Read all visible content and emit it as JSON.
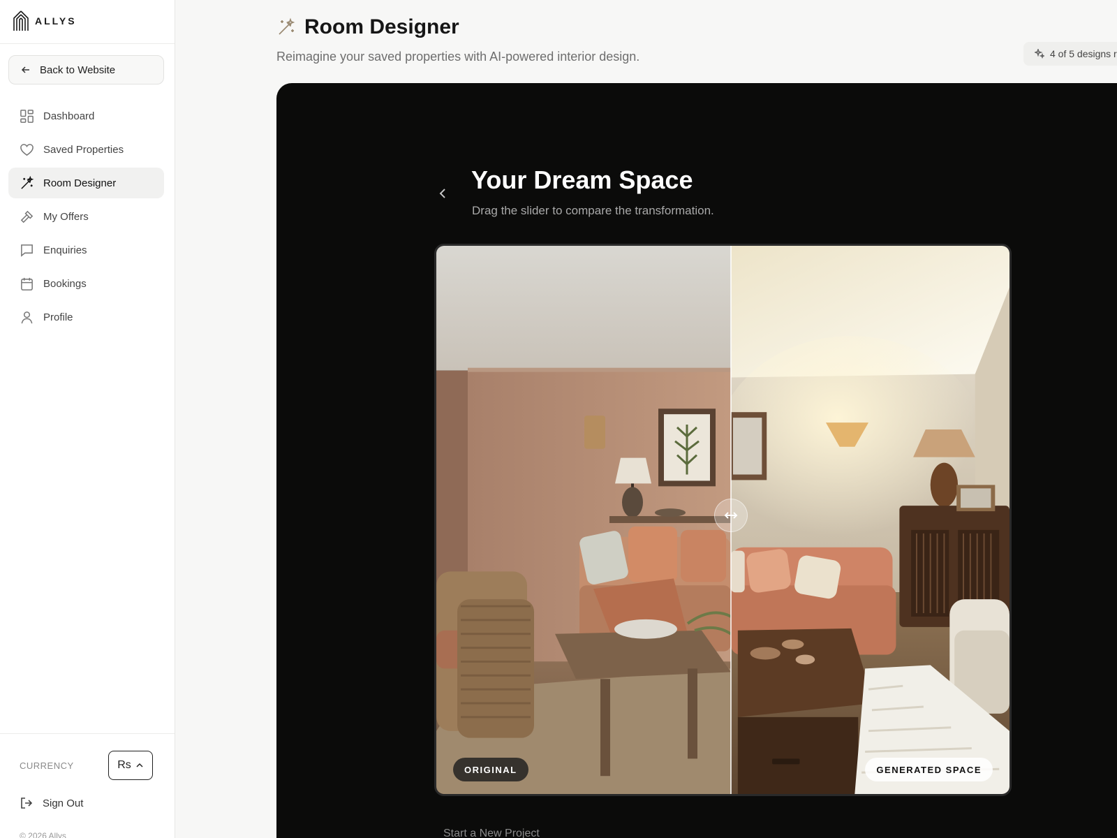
{
  "brand": {
    "name": "ALLYS"
  },
  "sidebar": {
    "back_label": "Back to Website",
    "items": [
      {
        "label": "Dashboard",
        "icon": "grid-icon"
      },
      {
        "label": "Saved Properties",
        "icon": "heart-icon"
      },
      {
        "label": "Room Designer",
        "icon": "magic-wand-icon",
        "active": true
      },
      {
        "label": "My Offers",
        "icon": "gavel-icon"
      },
      {
        "label": "Enquiries",
        "icon": "chat-icon"
      },
      {
        "label": "Bookings",
        "icon": "calendar-icon"
      },
      {
        "label": "Profile",
        "icon": "user-icon"
      }
    ],
    "currency_label": "CURRENCY",
    "currency_value": "Rs",
    "signout_label": "Sign Out",
    "copyright": "© 2026 Allys"
  },
  "header": {
    "title": "Room Designer",
    "subtitle": "Reimagine your saved properties with AI-powered interior design.",
    "usage": "4 of 5 designs r"
  },
  "panel": {
    "title": "Your Dream Space",
    "subtitle": "Drag the slider to compare the transformation.",
    "label_original": "ORIGINAL",
    "label_generated": "GENERATED SPACE",
    "slider_position_fraction": 0.51,
    "new_project": "Start a New Project"
  },
  "colors": {
    "accent": "#9a8a72",
    "panel_bg": "#0b0b0a",
    "active_nav_bg": "#f1f1f0"
  }
}
